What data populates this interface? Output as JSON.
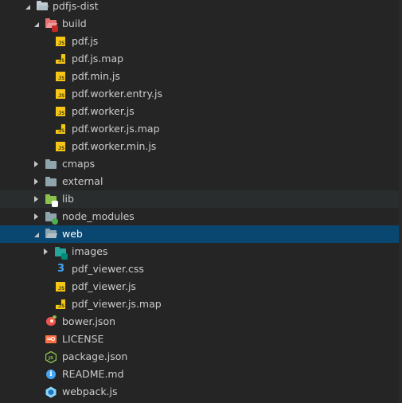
{
  "explorer": {
    "root": {
      "label": "pdfjs-dist",
      "icon": "folder-open-icon"
    },
    "build": {
      "label": "build",
      "icon": "folder-open-red-icon",
      "files": [
        {
          "label": "pdf.js",
          "icon": "javascript-icon"
        },
        {
          "label": "pdf.js.map",
          "icon": "javascript-map-icon"
        },
        {
          "label": "pdf.min.js",
          "icon": "javascript-icon"
        },
        {
          "label": "pdf.worker.entry.js",
          "icon": "javascript-icon"
        },
        {
          "label": "pdf.worker.js",
          "icon": "javascript-icon"
        },
        {
          "label": "pdf.worker.js.map",
          "icon": "javascript-map-icon"
        },
        {
          "label": "pdf.worker.min.js",
          "icon": "javascript-icon"
        }
      ]
    },
    "folders": [
      {
        "label": "cmaps",
        "icon": "folder-icon"
      },
      {
        "label": "external",
        "icon": "folder-icon"
      },
      {
        "label": "lib",
        "icon": "folder-lib-icon"
      },
      {
        "label": "node_modules",
        "icon": "folder-node-icon"
      }
    ],
    "web": {
      "label": "web",
      "icon": "folder-open-icon",
      "selected": true,
      "images": {
        "label": "images",
        "icon": "folder-images-icon"
      },
      "files": [
        {
          "label": "pdf_viewer.css",
          "icon": "css-icon"
        },
        {
          "label": "pdf_viewer.js",
          "icon": "javascript-icon"
        },
        {
          "label": "pdf_viewer.js.map",
          "icon": "javascript-map-icon"
        }
      ]
    },
    "root_files": [
      {
        "label": "bower.json",
        "icon": "bower-icon"
      },
      {
        "label": "LICENSE",
        "icon": "license-icon"
      },
      {
        "label": "package.json",
        "icon": "nodejs-icon"
      },
      {
        "label": "README.md",
        "icon": "info-icon"
      },
      {
        "label": "webpack.js",
        "icon": "webpack-icon"
      }
    ],
    "icon_glyphs": {
      "js": "JS",
      "css": "3",
      "info": "i"
    },
    "colors": {
      "background": "#252526",
      "selected_row": "#094771",
      "hover_row": "#2a2d2e",
      "text": "#cccccc",
      "js_yellow": "#f5c518",
      "css_blue": "#42a5f5"
    }
  }
}
